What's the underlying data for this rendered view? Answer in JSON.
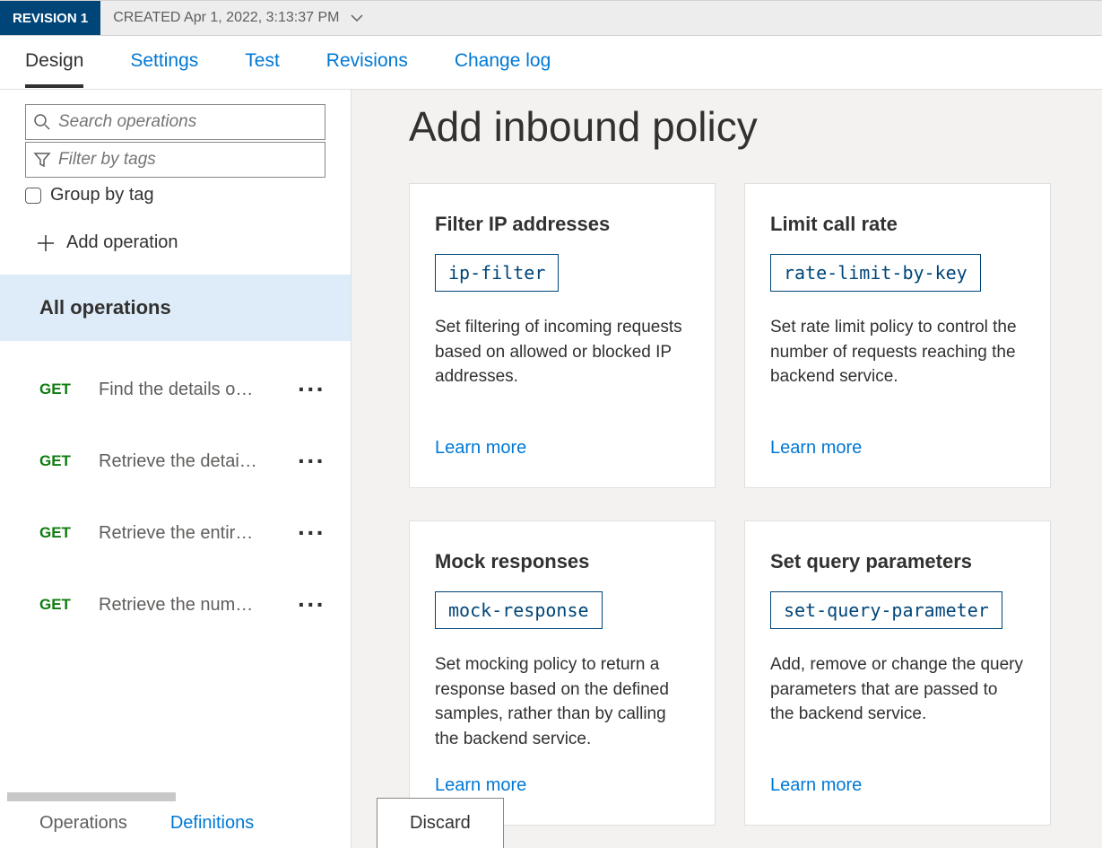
{
  "revision": {
    "label": "REVISION 1",
    "created": "CREATED Apr 1, 2022, 3:13:37 PM"
  },
  "tabs": [
    "Design",
    "Settings",
    "Test",
    "Revisions",
    "Change log"
  ],
  "sidebar": {
    "search_placeholder": "Search operations",
    "filter_placeholder": "Filter by tags",
    "group_by": "Group by tag",
    "add_operation": "Add operation",
    "all_operations": "All operations",
    "operations": [
      {
        "method": "GET",
        "name": "Find the details o…"
      },
      {
        "method": "GET",
        "name": "Retrieve the detai…"
      },
      {
        "method": "GET",
        "name": "Retrieve the entir…"
      },
      {
        "method": "GET",
        "name": "Retrieve the num…"
      }
    ],
    "bottom_tabs": {
      "operations": "Operations",
      "definitions": "Definitions"
    }
  },
  "main": {
    "title": "Add inbound policy",
    "cards": [
      {
        "title": "Filter IP addresses",
        "tag": "ip-filter",
        "desc": "Set filtering of incoming requests based on allowed or blocked IP addresses.",
        "learn": "Learn more"
      },
      {
        "title": "Limit call rate",
        "tag": "rate-limit-by-key",
        "desc": "Set rate limit policy to control the number of requests reaching the backend service.",
        "learn": "Learn more"
      },
      {
        "title": "Mock responses",
        "tag": "mock-response",
        "desc": "Set mocking policy to return a response based on the defined samples, rather than by calling the backend service.",
        "learn": "Learn more"
      },
      {
        "title": "Set query parameters",
        "tag": "set-query-parameter",
        "desc": "Add, remove or change the query parameters that are passed to the backend service.",
        "learn": "Learn more"
      }
    ],
    "discard": "Discard"
  }
}
